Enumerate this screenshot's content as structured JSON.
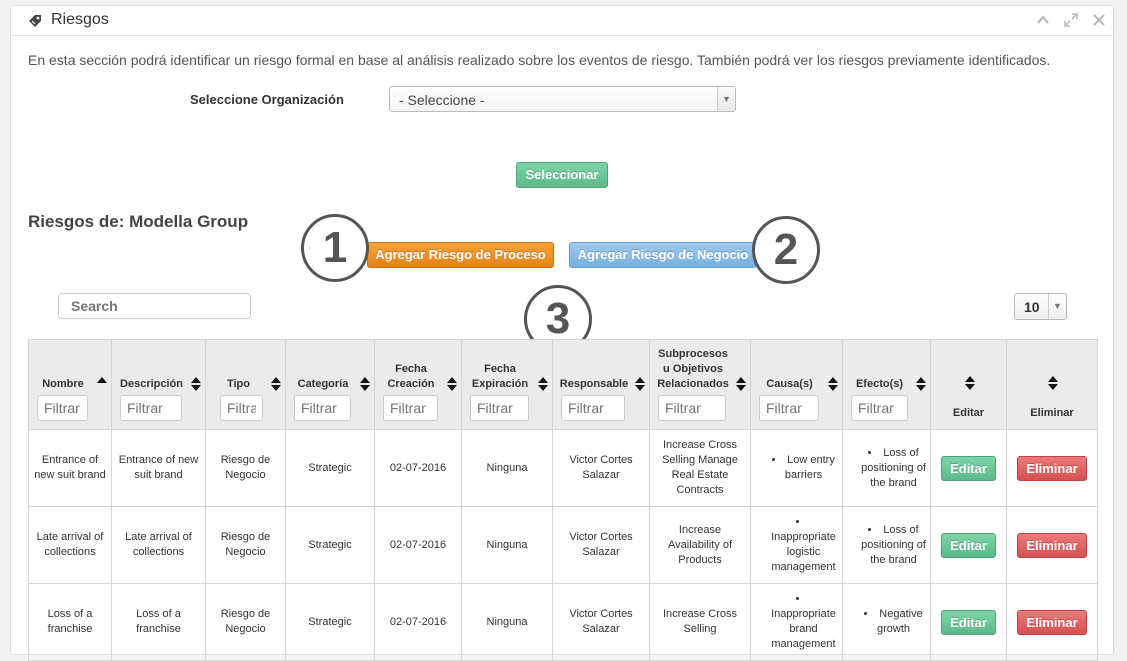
{
  "panel": {
    "title": "Riesgos",
    "icon": "tag-icon",
    "controls": [
      "collapse-icon",
      "expand-icon",
      "close-icon"
    ]
  },
  "intro_text": "En esta sección podrá identificar un riesgo formal en base al análisis realizado sobre los eventos de riesgo. También podrá ver los riesgos previamente identificados.",
  "org": {
    "label": "Seleccione Organización",
    "selected": "- Seleccione -"
  },
  "select_button": "Seleccionar",
  "section_title": "Riesgos de: Modella Group",
  "buttons": {
    "add_process_risk": "Agregar Riesgo de Proceso",
    "add_business_risk": "Agregar Riesgo de Negocio"
  },
  "callouts": [
    "1",
    "2",
    "3"
  ],
  "search": {
    "placeholder": "Search"
  },
  "page_size": "10",
  "table": {
    "columns": [
      "Nombre",
      "Descripción",
      "Tipo",
      "Categoría",
      "Fecha Creación",
      "Fecha Expiración",
      "Responsable",
      "Subprocesos u Objetivos Relacionados",
      "Causa(s)",
      "Efecto(s)",
      "Editar",
      "Eliminar"
    ],
    "filter_placeholder": "Filtrar",
    "edit_label": "Editar",
    "delete_label": "Eliminar",
    "rows": [
      {
        "nombre": "Entrance of new suit brand",
        "descripcion": "Entrance of new suit brand",
        "tipo": "Riesgo de Negocio",
        "categoria": "Strategic",
        "fecha_creacion": "02-07-2016",
        "fecha_expiracion": "Ninguna",
        "responsable": "Victor Cortes Salazar",
        "subprocesos": "Increase Cross Selling Manage Real Estate Contracts",
        "causa": "Low entry barriers",
        "efecto": "Loss of positioning of the brand"
      },
      {
        "nombre": "Late arrival of collections",
        "descripcion": "Late arrival of collections",
        "tipo": "Riesgo de Negocio",
        "categoria": "Strategic",
        "fecha_creacion": "02-07-2016",
        "fecha_expiracion": "Ninguna",
        "responsable": "Victor Cortes Salazar",
        "subprocesos": "Increase Availability of Products",
        "causa": "Inappropriate logistic management",
        "efecto": "Loss of positioning of the brand"
      },
      {
        "nombre": "Loss of a franchise",
        "descripcion": "Loss of a franchise",
        "tipo": "Riesgo de Negocio",
        "categoria": "Strategic",
        "fecha_creacion": "02-07-2016",
        "fecha_expiracion": "Ninguna",
        "responsable": "Victor Cortes Salazar",
        "subprocesos": "Increase Cross Selling",
        "causa": "Inappropriate brand management",
        "efecto": "Negative growth"
      }
    ]
  }
}
